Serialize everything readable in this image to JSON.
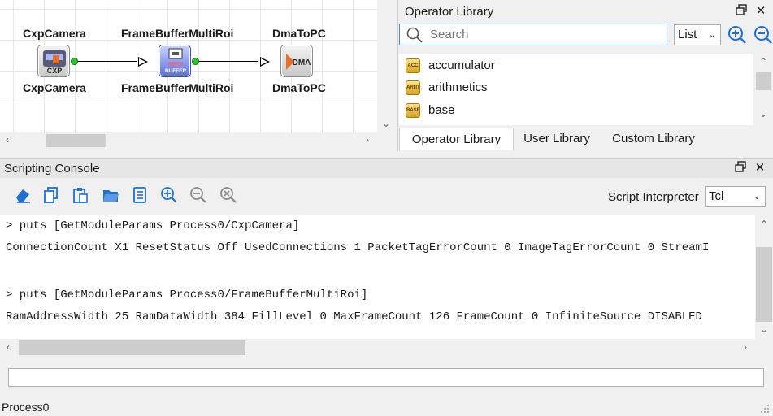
{
  "diagram": {
    "nodes": [
      {
        "label_top": "CxpCamera",
        "label_bottom": "CxpCamera",
        "icon": "camera-module-icon",
        "badge": "CXP"
      },
      {
        "label_top": "FrameBufferMultiRoi",
        "label_bottom": "FrameBufferMultiRoi",
        "icon": "buffer-module-icon",
        "badge": "BUFFER"
      },
      {
        "label_top": "DmaToPC",
        "label_bottom": "DmaToPC",
        "icon": "dma-module-icon",
        "badge": "DMA"
      }
    ]
  },
  "operator_library": {
    "title": "Operator Library",
    "search_placeholder": "Search",
    "view_mode": "List",
    "items": [
      {
        "label": "accumulator",
        "icon": "folder-icon"
      },
      {
        "label": "arithmetics",
        "icon": "folder-icon"
      },
      {
        "label": "base",
        "icon": "folder-icon"
      }
    ],
    "tabs": [
      {
        "label": "Operator Library",
        "active": true
      },
      {
        "label": "User Library",
        "active": false
      },
      {
        "label": "Custom Library",
        "active": false
      }
    ]
  },
  "console": {
    "title": "Scripting Console",
    "interpreter_label": "Script Interpreter",
    "interpreter_value": "Tcl",
    "lines": [
      "> puts [GetModuleParams Process0/CxpCamera]",
      "ConnectionCount X1 ResetStatus Off UsedConnections 1 PacketTagErrorCount 0 ImageTagErrorCount 0 StreamI",
      "",
      "> puts [GetModuleParams Process0/FrameBufferMultiRoi]",
      "RamAddressWidth 25 RamDataWidth 384 FillLevel 0 MaxFrameCount 126 FrameCount 0 InfiniteSource DISABLED"
    ],
    "input_value": ""
  },
  "status_bar": {
    "text": "Process0"
  },
  "colors": {
    "accent": "#1f6fd1",
    "port": "#28c828",
    "search_border": "#4a90d9"
  }
}
